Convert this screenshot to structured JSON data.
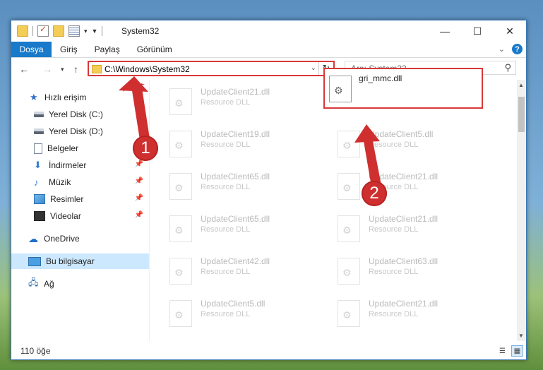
{
  "window": {
    "title": "System32",
    "controls": {
      "minimize": "—",
      "maximize": "☐",
      "close": "✕"
    }
  },
  "ribbon": {
    "file_tab": "Dosya",
    "tabs": [
      "Giriş",
      "Paylaş",
      "Görünüm"
    ]
  },
  "navigation": {
    "address": "C:\\Windows\\System32",
    "search_placeholder": "Ara: System32"
  },
  "sidebar": {
    "items": [
      {
        "label": "Hızlı erişim",
        "icon": "star-icon"
      },
      {
        "label": "Yerel Disk (C:)",
        "icon": "disk-icon"
      },
      {
        "label": "Yerel Disk (D:)",
        "icon": "disk-icon"
      },
      {
        "label": "Belgeler",
        "icon": "document-icon"
      },
      {
        "label": "İndirmeler",
        "icon": "download-icon"
      },
      {
        "label": "Müzik",
        "icon": "music-icon"
      },
      {
        "label": "Resimler",
        "icon": "pictures-icon"
      },
      {
        "label": "Videolar",
        "icon": "video-icon"
      },
      {
        "label": "OneDrive",
        "icon": "cloud-icon"
      },
      {
        "label": "Bu bilgisayar",
        "icon": "computer-icon"
      },
      {
        "label": "Ağ",
        "icon": "network-icon"
      }
    ]
  },
  "files": {
    "highlighted": {
      "name": "gri_mmc.dll"
    },
    "left_column": [
      {
        "name": "UpdateClient21.dll",
        "type": "Resource DLL"
      },
      {
        "name": "UpdateClient19.dll",
        "type": "Resource DLL"
      },
      {
        "name": "UpdateClient65.dll",
        "type": "Resource DLL"
      },
      {
        "name": "UpdateClient65.dll",
        "type": "Resource DLL"
      },
      {
        "name": "UpdateClient42.dll",
        "type": "Resource DLL"
      },
      {
        "name": "UpdateClient5.dll",
        "type": "Resource DLL"
      }
    ],
    "right_column": [
      {
        "name": "UpdateClient5.dll",
        "type": "Resource DLL"
      },
      {
        "name": "UpdateClient21.dll",
        "type": "Resource DLL"
      },
      {
        "name": "UpdateClient21.dll",
        "type": "Resource DLL"
      },
      {
        "name": "UpdateClient63.dll",
        "type": "Resource DLL"
      },
      {
        "name": "UpdateClient21.dll",
        "type": "Resource DLL"
      }
    ]
  },
  "status": {
    "count": "110 öğe"
  },
  "callouts": {
    "one": "1",
    "two": "2"
  },
  "colors": {
    "accent": "#1979ca",
    "highlight": "#d93838",
    "selection": "#cce8ff"
  }
}
